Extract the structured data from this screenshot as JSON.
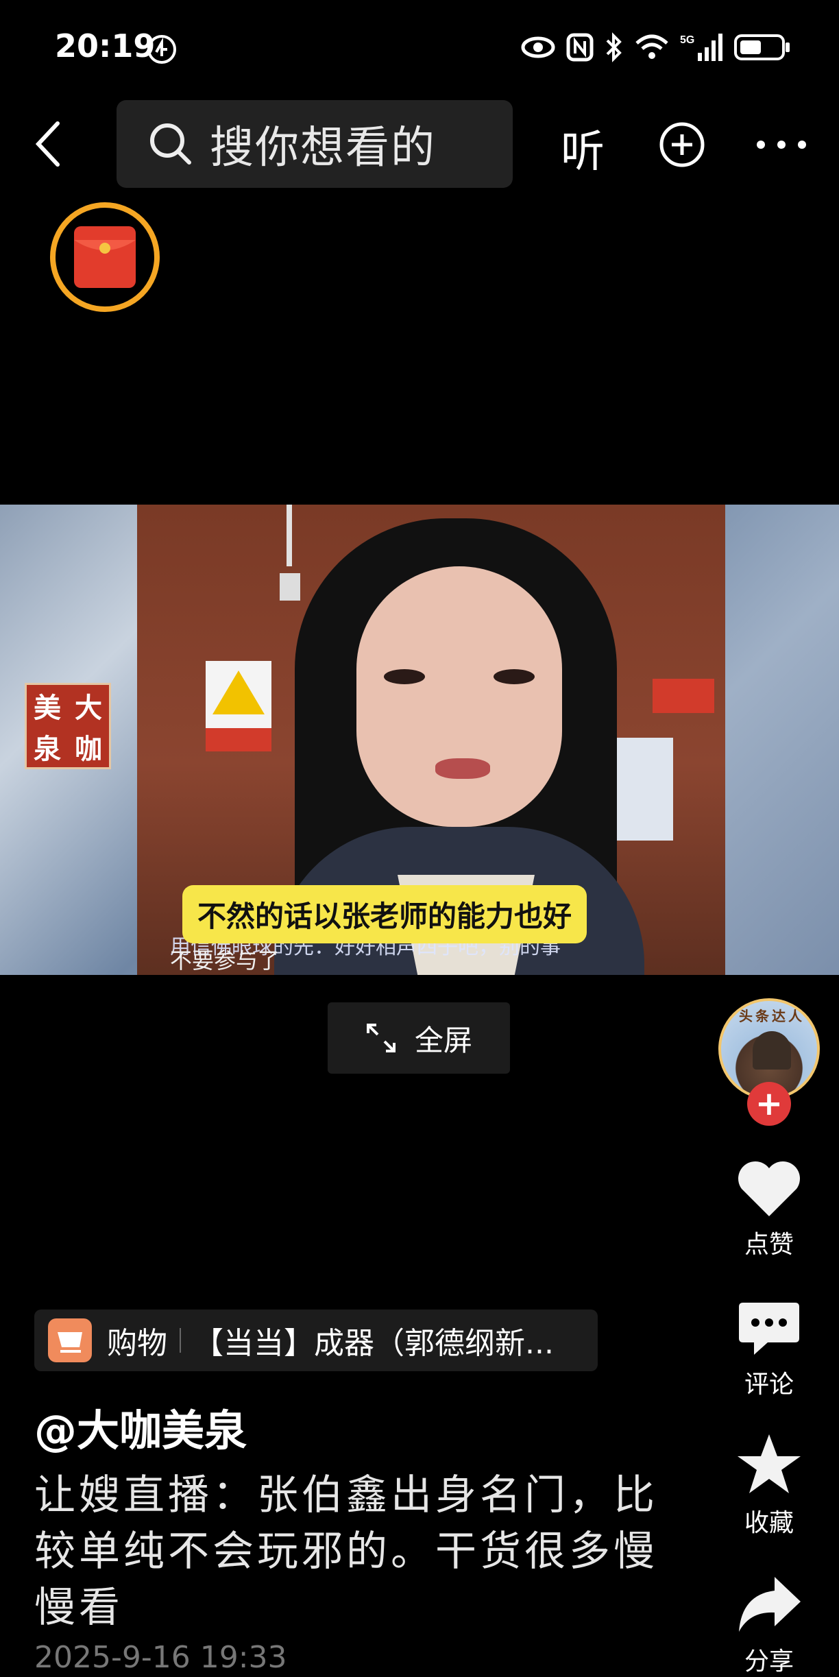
{
  "status_bar": {
    "time": "20:19",
    "icons": [
      "badge-icon",
      "eye-icon",
      "nfc-icon",
      "bluetooth-icon",
      "wifi-icon",
      "5g-signal-icon",
      "battery-icon"
    ]
  },
  "top_nav": {
    "search_placeholder": "搜你想看的",
    "listen_label": "听"
  },
  "video": {
    "subtitle": "不然的话以张老师的能力也好",
    "subtitle_second_line": "不要参与了",
    "chat_overlay": "用信佛眼球的先：好好相声四子吧，别的事",
    "logo_chars": [
      "美",
      "大",
      "泉",
      "咖"
    ],
    "fullscreen_label": "全屏"
  },
  "right_rail": {
    "avatar_banner": "头条达人",
    "follow_symbol": "+",
    "like_label": "点赞",
    "comment_label": "评论",
    "favorite_label": "收藏",
    "share_label": "分享"
  },
  "product": {
    "type": "购物",
    "title": "【当当】成器（郭德纲新..."
  },
  "post": {
    "author": "@大咖美泉",
    "caption": "让嫂直播：张伯鑫出身名门，比较单纯不会玩邪的。干货很多慢慢看",
    "date": "2025-9-16 19:33"
  },
  "colors": {
    "background": "#000000",
    "subtitle_bg": "#f7e64a",
    "follow_red": "#e03a3a",
    "cart_orange": "#f08b5c"
  }
}
